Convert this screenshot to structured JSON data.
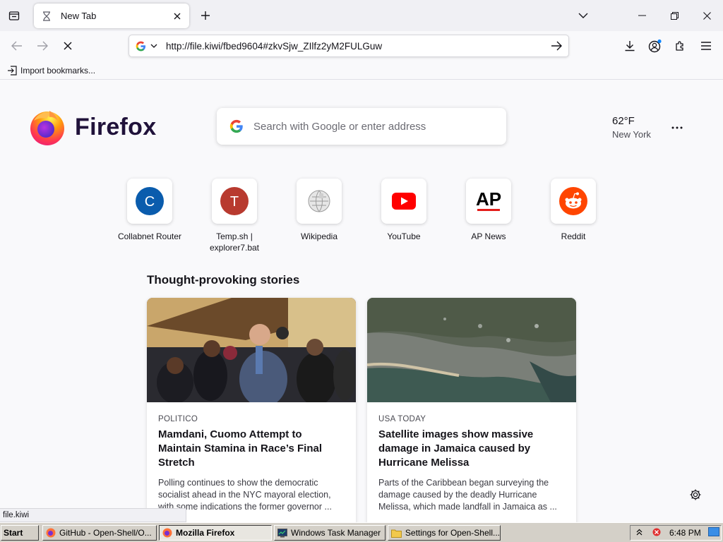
{
  "browser": {
    "tab": {
      "title": "New Tab"
    },
    "urlbar": {
      "value": "http://file.kiwi/fbed9604#zkvSjw_ZIlfz2yM2FULGuw"
    },
    "bookmarks": {
      "import_label": "Import bookmarks..."
    }
  },
  "newtab": {
    "logo_text": "Firefox",
    "search_placeholder": "Search with Google or enter address",
    "weather": {
      "temp": "62°F",
      "city": "New York"
    },
    "shortcuts": [
      {
        "label": "Collabnet Router",
        "letter": "C",
        "color": "#0a5cad"
      },
      {
        "label": "Temp.sh | explorer7.bat",
        "letter": "T",
        "color": "#c0392b"
      },
      {
        "label": "Wikipedia",
        "icon": "wikipedia-globe-icon"
      },
      {
        "label": "YouTube",
        "icon": "youtube-play-icon",
        "color": "#ff0000"
      },
      {
        "label": "AP News",
        "logo": "AP",
        "icon": "ap-news-logo"
      },
      {
        "label": "Reddit",
        "icon": "reddit-alien-icon",
        "color": "#ff4500"
      }
    ],
    "stories_title": "Thought-provoking stories",
    "stories": [
      {
        "source": "POLITICO",
        "headline": "Mamdani, Cuomo Attempt to Maintain Stamina in Race’s Final Stretch",
        "excerpt": "Polling continues to show the democratic socialist ahead in the NYC mayoral election, with some indications the former governor ..."
      },
      {
        "source": "USA TODAY",
        "headline": "Satellite images show massive damage in Jamaica caused by Hurricane Melissa",
        "excerpt": "Parts of the Caribbean began surveying the damage caused by the deadly Hurricane Melissa, which made landfall in Jamaica as ..."
      }
    ],
    "status_text": "file.kiwi"
  },
  "taskbar": {
    "start_label": "Start",
    "tasks": [
      {
        "label": "GitHub - Open-Shell/O..."
      },
      {
        "label": "Mozilla Firefox"
      },
      {
        "label": "Windows Task Manager"
      },
      {
        "label": "Settings for Open-Shell..."
      }
    ],
    "clock": "6:48 PM"
  }
}
